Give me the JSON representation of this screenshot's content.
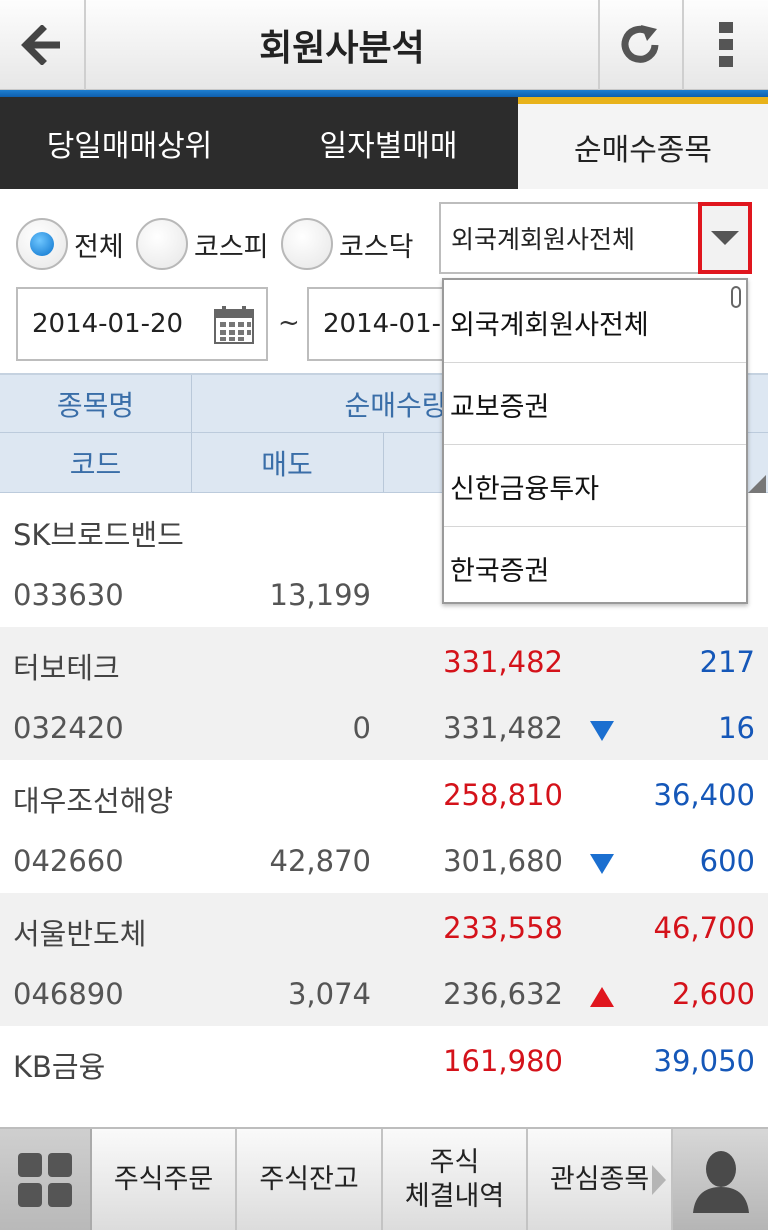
{
  "header": {
    "title": "회원사분석",
    "back_icon": "arrow-left-icon",
    "refresh_icon": "refresh-icon",
    "menu_icon": "more-vert-icon"
  },
  "tabs": [
    {
      "label": "당일매매상위",
      "active": false
    },
    {
      "label": "일자별매매",
      "active": false
    },
    {
      "label": "순매수종목",
      "active": true
    }
  ],
  "filters": {
    "market_options": [
      {
        "label": "전체",
        "selected": true
      },
      {
        "label": "코스피",
        "selected": false
      },
      {
        "label": "코스닥",
        "selected": false
      }
    ],
    "member_select": {
      "value": "외국계회원사전체"
    },
    "date_from": "2014-01-20",
    "date_to": "2014-01-",
    "date_separator": "~"
  },
  "table": {
    "header_row1": {
      "name": "종목명",
      "net_qty": "순매수량"
    },
    "header_row2": {
      "code": "코드",
      "sell": "매도"
    },
    "rows": [
      {
        "name": "SK브로드밴드",
        "code": "033630",
        "sell": "13,199",
        "net": "",
        "buy": "",
        "price": "",
        "change": "",
        "dir": ""
      },
      {
        "name": "터보테크",
        "code": "032420",
        "sell": "0",
        "net": "331,482",
        "buy": "331,482",
        "price": "217",
        "change": "16",
        "dir": "down"
      },
      {
        "name": "대우조선해양",
        "code": "042660",
        "sell": "42,870",
        "net": "258,810",
        "buy": "301,680",
        "price": "36,400",
        "change": "600",
        "dir": "down"
      },
      {
        "name": "서울반도체",
        "code": "046890",
        "sell": "3,074",
        "net": "233,558",
        "buy": "236,632",
        "price": "46,700",
        "change": "2,600",
        "dir": "up"
      },
      {
        "name": "KB금융",
        "code": "",
        "sell": "",
        "net": "161,980",
        "buy": "",
        "price": "39,050",
        "change": "",
        "dir": ""
      }
    ]
  },
  "dropdown": {
    "items": [
      "외국계회원사전체",
      "교보증권",
      "신한금융투자",
      "한국증권"
    ]
  },
  "bottom_bar": {
    "grid_icon": "grid-icon",
    "buttons": [
      "주식주문",
      "주식잔고",
      "주식\n체결내역",
      "관심종목"
    ],
    "user_icon": "user-icon"
  }
}
